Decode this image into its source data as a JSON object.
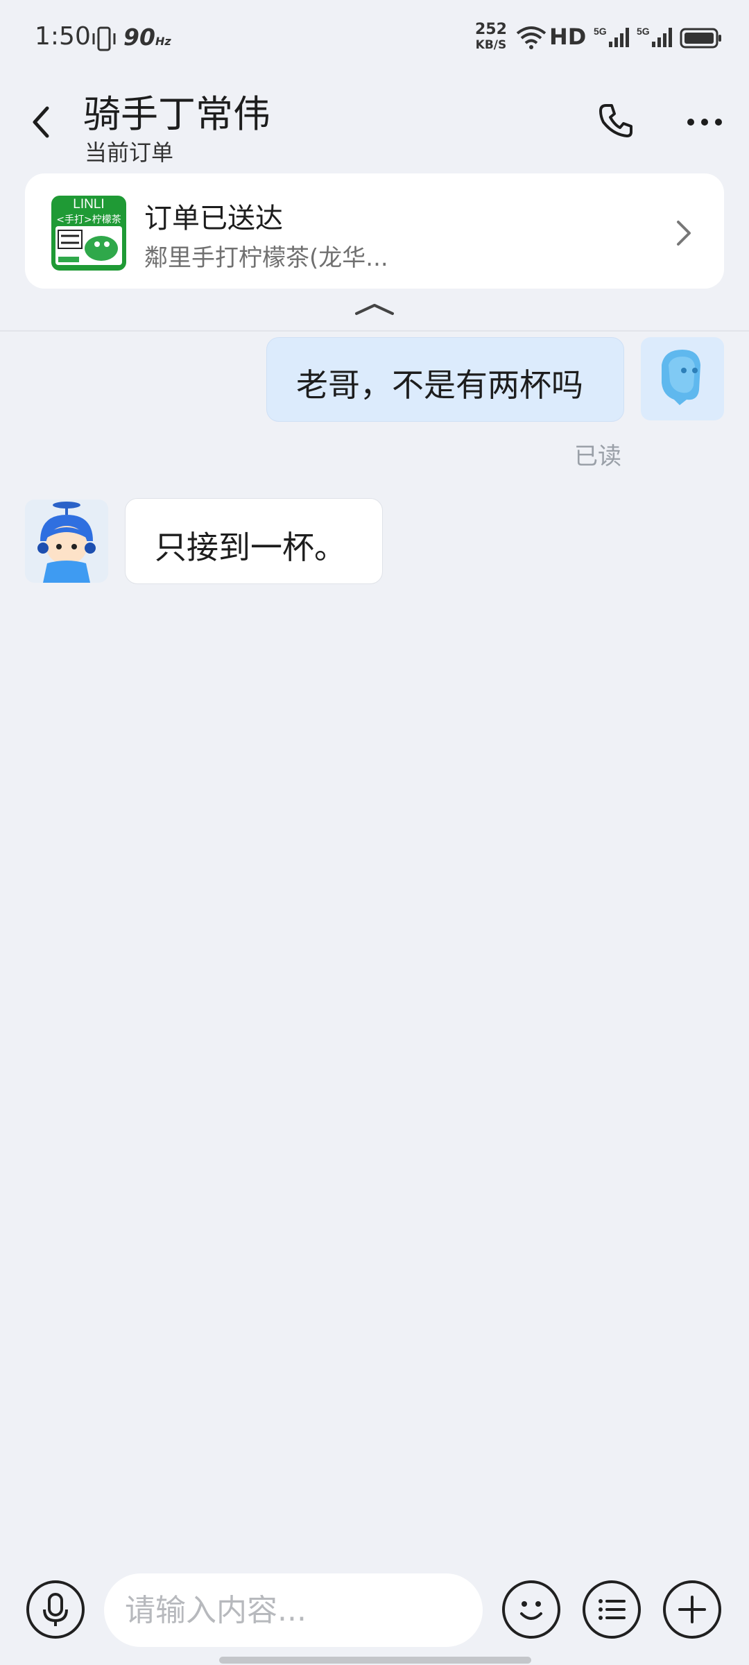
{
  "status_bar": {
    "time": "1:50",
    "refresh_rate": "90",
    "refresh_unit": "Hz",
    "net_speed": "252",
    "net_unit": "KB/S",
    "hd_label": "HD",
    "network_1": "5G",
    "network_2": "5G"
  },
  "header": {
    "title": "骑手丁常伟",
    "subtitle": "当前订单"
  },
  "order": {
    "status": "订单已送达",
    "shop": "鄰里手打柠檬茶(龙华...",
    "logo_brand": "LINLI",
    "logo_sub": "<手打>柠檬茶"
  },
  "messages": [
    {
      "side": "outgoing",
      "text": "老哥，不是有两杯吗",
      "read_status": "已读"
    },
    {
      "side": "incoming",
      "text": "只接到一杯。"
    }
  ],
  "input": {
    "placeholder": "请输入内容..."
  },
  "colors": {
    "background": "#eff1f6",
    "outgoing_bubble": "#dcebfc",
    "logo_green": "#1f9a35"
  }
}
